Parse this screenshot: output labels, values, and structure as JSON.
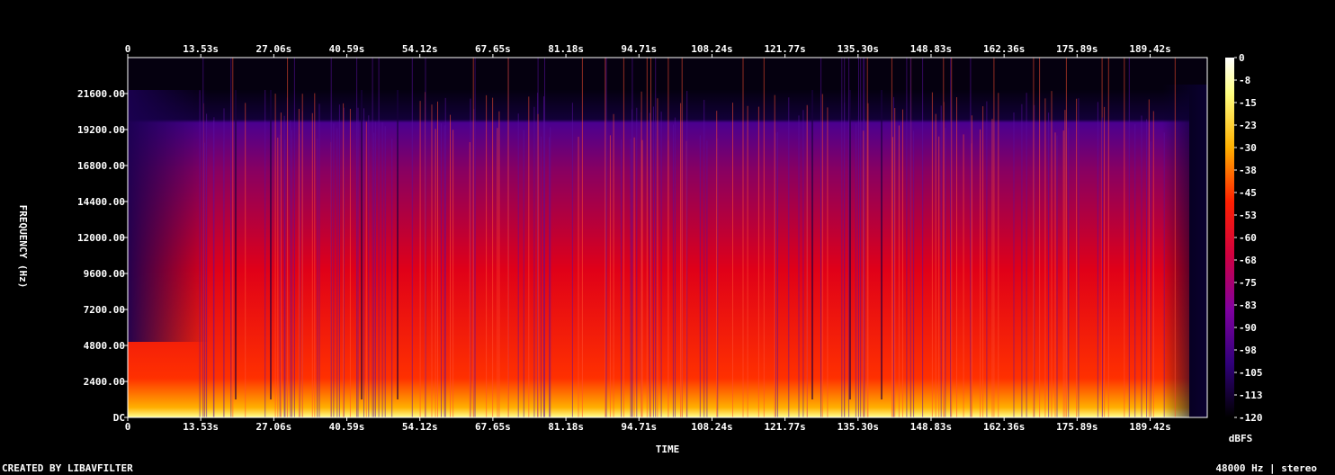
{
  "chart_data": {
    "type": "heatmap",
    "xlabel": "TIME",
    "ylabel": "FREQUENCY (Hz)",
    "colorbar_label": "dBFS",
    "x_ticks": [
      "0",
      "13.53s",
      "27.06s",
      "40.59s",
      "54.12s",
      "67.65s",
      "81.18s",
      "94.71s",
      "108.24s",
      "121.77s",
      "135.30s",
      "148.83s",
      "162.36s",
      "175.89s",
      "189.42s"
    ],
    "x_tick_values": [
      0,
      13.53,
      27.06,
      40.59,
      54.12,
      67.65,
      81.18,
      94.71,
      108.24,
      121.77,
      135.3,
      148.83,
      162.36,
      175.89,
      189.42
    ],
    "xlim": [
      0,
      200
    ],
    "y_ticks": [
      "DC",
      "2400.00",
      "4800.00",
      "7200.00",
      "9600.00",
      "12000.00",
      "14400.00",
      "16800.00",
      "19200.00",
      "21600.00"
    ],
    "y_tick_values": [
      0,
      2400,
      4800,
      7200,
      9600,
      12000,
      14400,
      16800,
      19200,
      21600
    ],
    "ylim": [
      0,
      24000
    ],
    "colorbar_ticks": [
      "0",
      "-8",
      "-15",
      "-23",
      "-30",
      "-38",
      "-45",
      "-53",
      "-60",
      "-68",
      "-75",
      "-83",
      "-90",
      "-98",
      "-105",
      "-113",
      "-120"
    ],
    "colorbar_range": [
      -120,
      0
    ],
    "colormap": [
      "#000000",
      "#1a0040",
      "#3c0096",
      "#7a00a0",
      "#c0007a",
      "#ff0000",
      "#ff6a00",
      "#ffd000",
      "#ffffa0",
      "#ffffff"
    ]
  },
  "footer": {
    "credit": "CREATED BY LIBAVFILTER",
    "info": "48000 Hz | stereo"
  }
}
